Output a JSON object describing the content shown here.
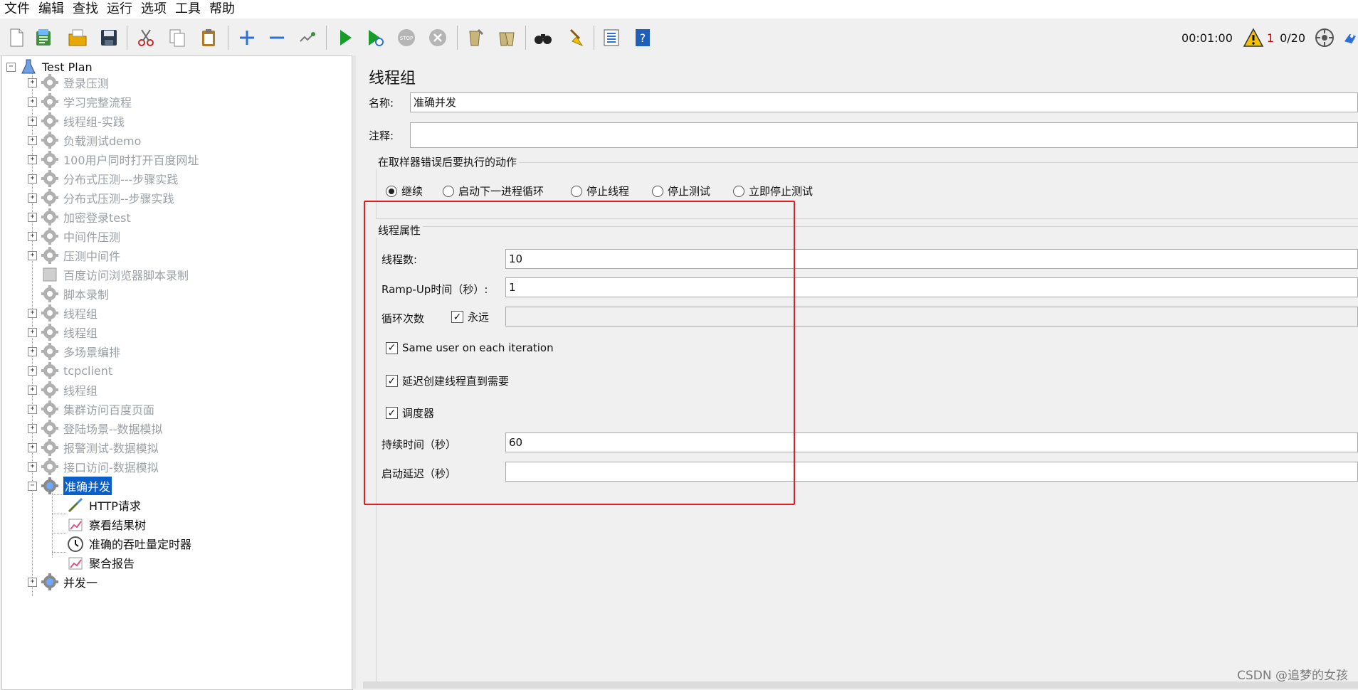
{
  "menu": [
    "文件",
    "编辑",
    "查找",
    "运行",
    "选项",
    "工具",
    "帮助"
  ],
  "toolbar": {
    "icons": [
      "new-icon",
      "templates-icon",
      "open-icon",
      "save-icon",
      "cut-icon",
      "copy-icon",
      "paste-icon",
      "expand-icon",
      "collapse-icon",
      "toggle-icon",
      "start-icon",
      "start-no-pauses-icon",
      "stop-icon",
      "shutdown-icon",
      "clear-icon",
      "clear-all-icon",
      "search-icon",
      "reset-search-icon",
      "function-helper-icon",
      "help-icon"
    ],
    "timer": "00:01:00",
    "warning_count": "1",
    "threads": "0/20",
    "colors": {
      "start": "#1a9c2a",
      "warning": "#f2c200"
    }
  },
  "tree": {
    "root": "Test Plan",
    "items": [
      {
        "label": "登录压测",
        "expander": "+"
      },
      {
        "label": "学习完整流程",
        "expander": "+"
      },
      {
        "label": "线程组-实践",
        "expander": "+"
      },
      {
        "label": "负载测试demo",
        "expander": "+"
      },
      {
        "label": "100用户同时打开百度网址",
        "expander": "+"
      },
      {
        "label": "分布式压测---步骤实践",
        "expander": "+"
      },
      {
        "label": "分布式压测--步骤实践",
        "expander": "+"
      },
      {
        "label": "加密登录test",
        "expander": "+"
      },
      {
        "label": "中间件压测",
        "expander": "+"
      },
      {
        "label": "压测中间件",
        "expander": "+"
      },
      {
        "label": "百度访问浏览器脚本录制",
        "expander": ""
      },
      {
        "label": "脚本录制",
        "expander": ""
      },
      {
        "label": "线程组",
        "expander": "+"
      },
      {
        "label": "线程组",
        "expander": "+"
      },
      {
        "label": "多场景编排",
        "expander": "+"
      },
      {
        "label": "tcpclient",
        "expander": "+"
      },
      {
        "label": "线程组",
        "expander": "+"
      },
      {
        "label": "集群访问百度页面",
        "expander": "+"
      },
      {
        "label": "登陆场景--数据模拟",
        "expander": "+"
      },
      {
        "label": "报警测试-数据模拟",
        "expander": "+"
      },
      {
        "label": "接口访问-数据模拟",
        "expander": "+"
      },
      {
        "label": "准确并发",
        "expander": "-"
      }
    ],
    "children": [
      "HTTP请求",
      "察看结果树",
      "准确的吞吐量定时器",
      "聚合报告"
    ],
    "last": "并发一"
  },
  "panel": {
    "title": "线程组",
    "name_label": "名称:",
    "name_value": "准确并发",
    "comment_label": "注释:",
    "comment_value": "",
    "error_group": {
      "legend": "在取样器错误后要执行的动作",
      "options": [
        "继续",
        "启动下一进程循环",
        "停止线程",
        "停止测试",
        "立即停止测试"
      ],
      "selected": "继续"
    },
    "thread_props": {
      "legend": "线程属性",
      "threads_label": "线程数:",
      "threads_value": "10",
      "rampup_label": "Ramp-Up时间（秒）:",
      "rampup_value": "1",
      "loop_label": "循环次数",
      "forever_label": "永远",
      "forever_checked": true,
      "loop_value": "",
      "same_user_label": "Same user on each iteration",
      "same_user_checked": true,
      "delay_label": "延迟创建线程直到需要",
      "delay_checked": true,
      "scheduler_label": "调度器",
      "scheduler_checked": true,
      "duration_label": "持续时间（秒）",
      "duration_value": "60",
      "startup_label": "启动延迟（秒）",
      "startup_value": ""
    }
  },
  "watermark": "CSDN @追梦的女孩"
}
